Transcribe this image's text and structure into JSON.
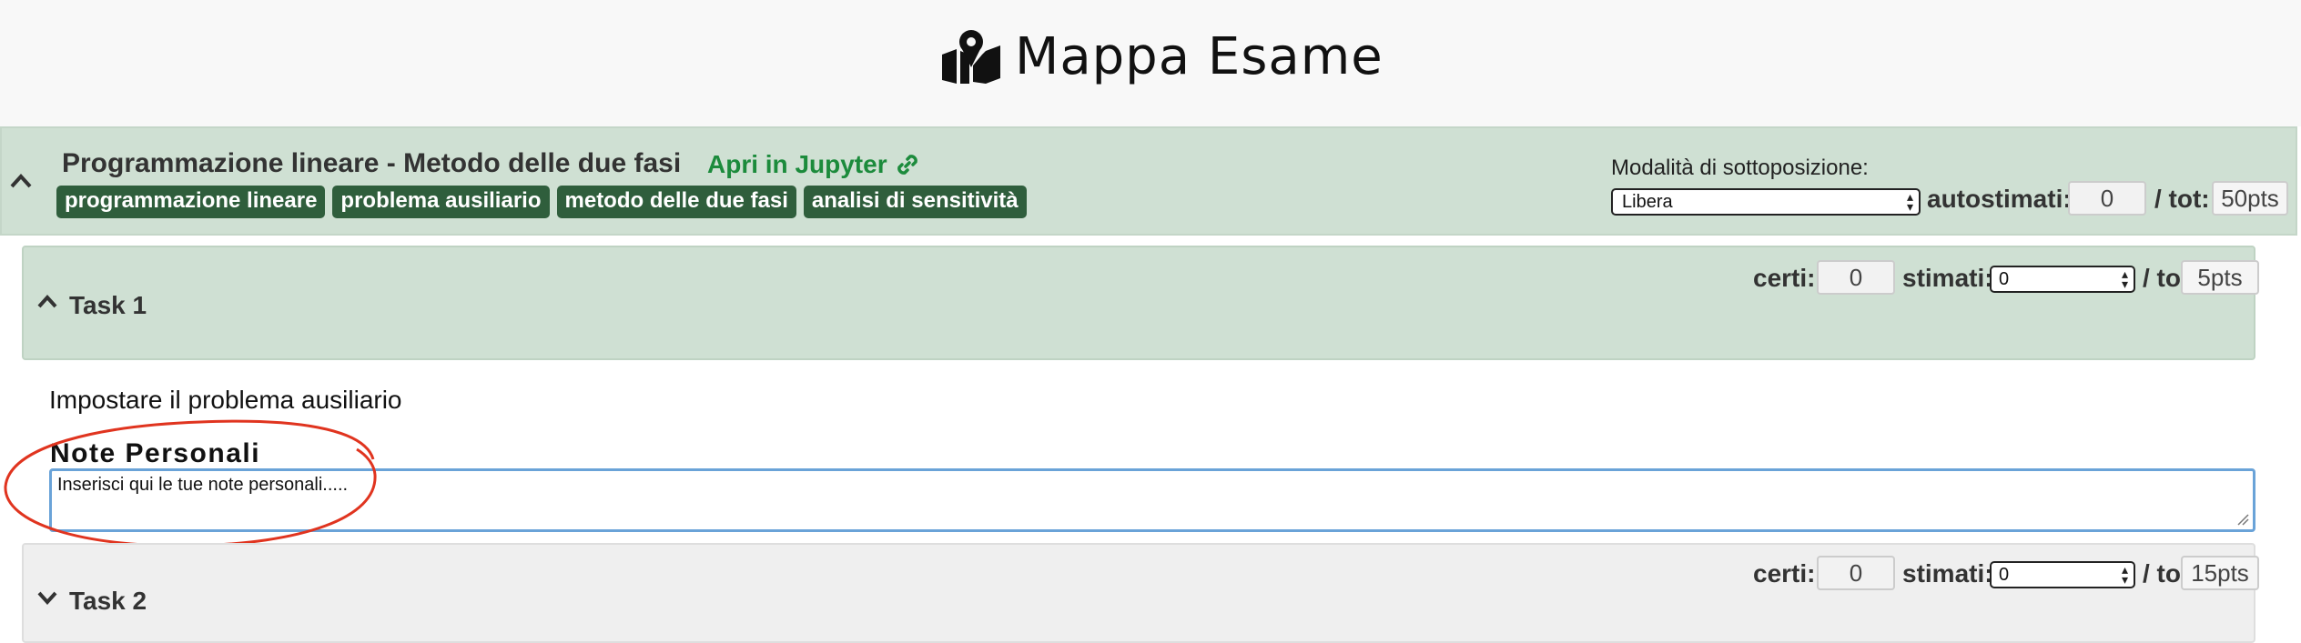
{
  "app": {
    "title": "Mappa Esame"
  },
  "exam": {
    "title": "Programmazione lineare - Metodo delle due fasi",
    "jupyter_link": "Apri in Jupyter",
    "tags": [
      "programmazione lineare",
      "problema ausiliario",
      "metodo delle due fasi",
      "analisi di sensitività"
    ],
    "mode_label": "Modalità di sottoposizione:",
    "mode_value": "Libera",
    "autostimati_label": "autostimati:",
    "autostimati_value": "0",
    "tot_label": "/ tot:",
    "tot_value": "50pts"
  },
  "tasks": [
    {
      "title": "Task 1",
      "expanded": true,
      "certi_label": "certi:",
      "certi_value": "0",
      "stimati_label": "stimati:",
      "stimati_value": "0",
      "total_label": "/ total:",
      "total_value": "5pts",
      "description": "Impostare il problema ausiliario",
      "notes_title": "Note Personali",
      "notes_placeholder": "Inserisci qui le tue note personali....."
    },
    {
      "title": "Task 2",
      "expanded": false,
      "certi_label": "certi:",
      "certi_value": "0",
      "stimati_label": "stimati:",
      "stimati_value": "0",
      "total_label": "/ total:",
      "total_value": "15pts"
    }
  ],
  "colors": {
    "header_green": "#cfe0d3",
    "tag_green": "#2f5e3c",
    "link_green": "#1c8b3c",
    "annotation_red": "#e0341f",
    "focus_blue": "#6aa3d8"
  },
  "icons": {
    "app_icon": "map-marked-icon",
    "link_icon": "link-icon",
    "collapse_icon": "chevron-up-icon",
    "expand_icon": "chevron-down-icon"
  }
}
